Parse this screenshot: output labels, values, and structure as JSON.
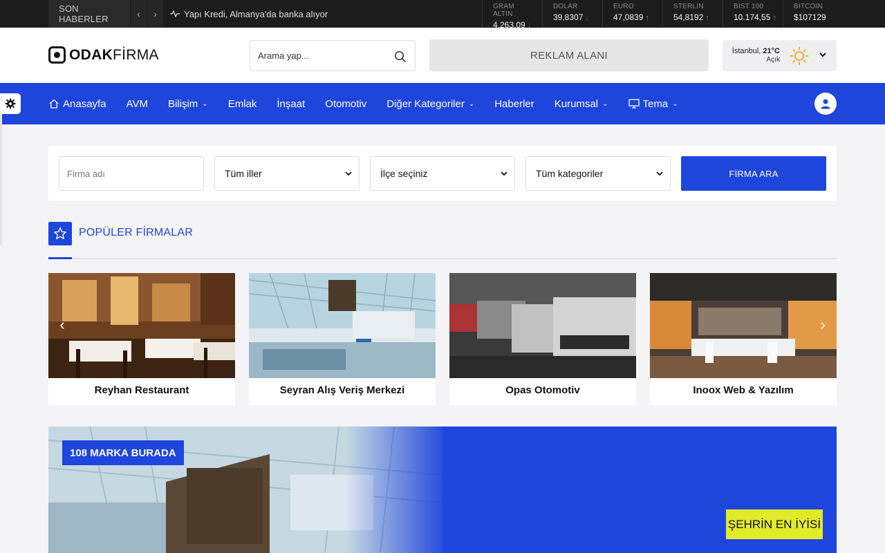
{
  "topbar": {
    "label": "SON HABERLER",
    "headline": "Yapı Kredi, Almanya'da banka alıyor",
    "markets": [
      {
        "name": "GRAM ALTIN",
        "value": "4.263,09",
        "trend": "down"
      },
      {
        "name": "DOLAR",
        "value": "39,8307",
        "trend": "down"
      },
      {
        "name": "EURO",
        "value": "47,0839",
        "trend": "up"
      },
      {
        "name": "STERLIN",
        "value": "54,8192",
        "trend": "up"
      },
      {
        "name": "BIST 100",
        "value": "10.174,55",
        "trend": "up"
      },
      {
        "name": "BITCOIN",
        "value": "$107129",
        "trend": ""
      }
    ]
  },
  "header": {
    "logo_bold": "ODAK",
    "logo_light": "FİRMA",
    "search_placeholder": "Arama yap...",
    "ad_label": "REKLAM ALANI",
    "weather": {
      "city": "İstanbul,",
      "temp": "21°C",
      "condition": "Açık"
    }
  },
  "nav": {
    "items": [
      {
        "label": "Anasayfa",
        "dropdown": false
      },
      {
        "label": "AVM",
        "dropdown": false
      },
      {
        "label": "Bilişim",
        "dropdown": true
      },
      {
        "label": "Emlak",
        "dropdown": false
      },
      {
        "label": "İnşaat",
        "dropdown": false
      },
      {
        "label": "Otomotiv",
        "dropdown": false
      },
      {
        "label": "Diğer Kategoriler",
        "dropdown": true
      },
      {
        "label": "Haberler",
        "dropdown": false
      },
      {
        "label": "Kurumsal",
        "dropdown": true
      },
      {
        "label": "Tema",
        "dropdown": true
      }
    ]
  },
  "filter": {
    "name_placeholder": "Firma adı",
    "city": "Tüm iller",
    "district": "İlçe seçiniz",
    "category": "Tüm kategoriler",
    "button": "FİRMA ARA"
  },
  "popular": {
    "title": "POPÜLER FİRMALAR",
    "cards": [
      {
        "title": "Reyhan Restaurant"
      },
      {
        "title": "Seyran Alış Veriş Merkezi"
      },
      {
        "title": "Opas Otomotiv"
      },
      {
        "title": "Inoox Web & Yazılım"
      }
    ]
  },
  "banner": {
    "tag": "108 MARKA BURADA",
    "cta": "ŞEHRİN EN İYİSİ"
  },
  "colors": {
    "primary": "#1e45dc",
    "topbar": "#1c1c1c",
    "cta": "#e2ea2a"
  }
}
